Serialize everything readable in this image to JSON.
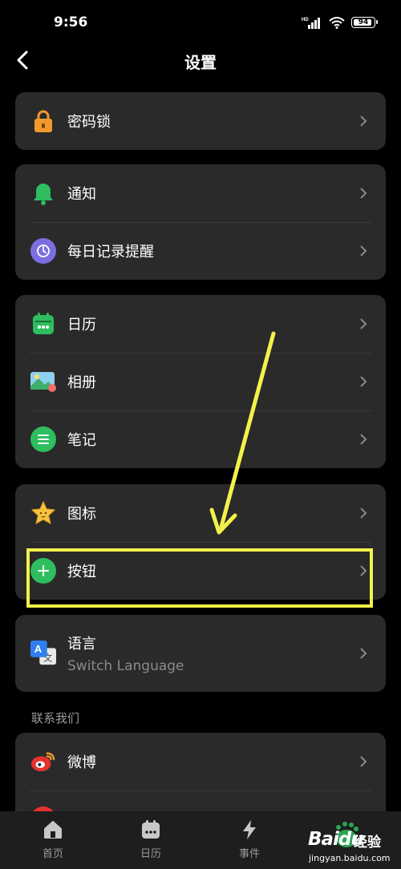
{
  "status_bar": {
    "time": "9:56",
    "signal_label": "HD",
    "battery": "94"
  },
  "header": {
    "title": "设置"
  },
  "groups": [
    {
      "items": [
        {
          "label": "密码锁",
          "icon": "lock-icon",
          "color": "#f29a2e"
        }
      ]
    },
    {
      "items": [
        {
          "label": "通知",
          "icon": "bell-icon",
          "color": "#2ebd5f"
        },
        {
          "label": "每日记录提醒",
          "icon": "moon-clock-icon",
          "color": "#7b6fe0"
        }
      ]
    },
    {
      "items": [
        {
          "label": "日历",
          "icon": "calendar-icon",
          "color": "#2ebd5f"
        },
        {
          "label": "相册",
          "icon": "photo-icon",
          "color": "#8fd0f0"
        },
        {
          "label": "笔记",
          "icon": "notes-icon",
          "color": "#2ebd5f"
        }
      ]
    },
    {
      "items": [
        {
          "label": "图标",
          "icon": "star-icon",
          "color": "#f5c542"
        },
        {
          "label": "按钮",
          "icon": "plus-circle-icon",
          "color": "#2ebd5f"
        }
      ]
    },
    {
      "items": [
        {
          "label": "语言",
          "sublabel": "Switch Language",
          "icon": "translate-icon",
          "color": "#2d7ff0"
        }
      ]
    }
  ],
  "contact": {
    "title": "联系我们",
    "items": [
      {
        "label": "微博",
        "icon": "weibo-icon",
        "color": "#e6322e"
      }
    ]
  },
  "tabbar": {
    "tabs": [
      {
        "label": "首页",
        "icon": "home-icon"
      },
      {
        "label": "日历",
        "icon": "calendar-icon"
      },
      {
        "label": "事件",
        "icon": "lightning-icon"
      }
    ]
  },
  "annotation": {
    "highlight_color": "#f2f24a"
  },
  "watermark": {
    "brand": "Baidu",
    "cn": "经验",
    "url": "jingyan.baidu.com"
  }
}
